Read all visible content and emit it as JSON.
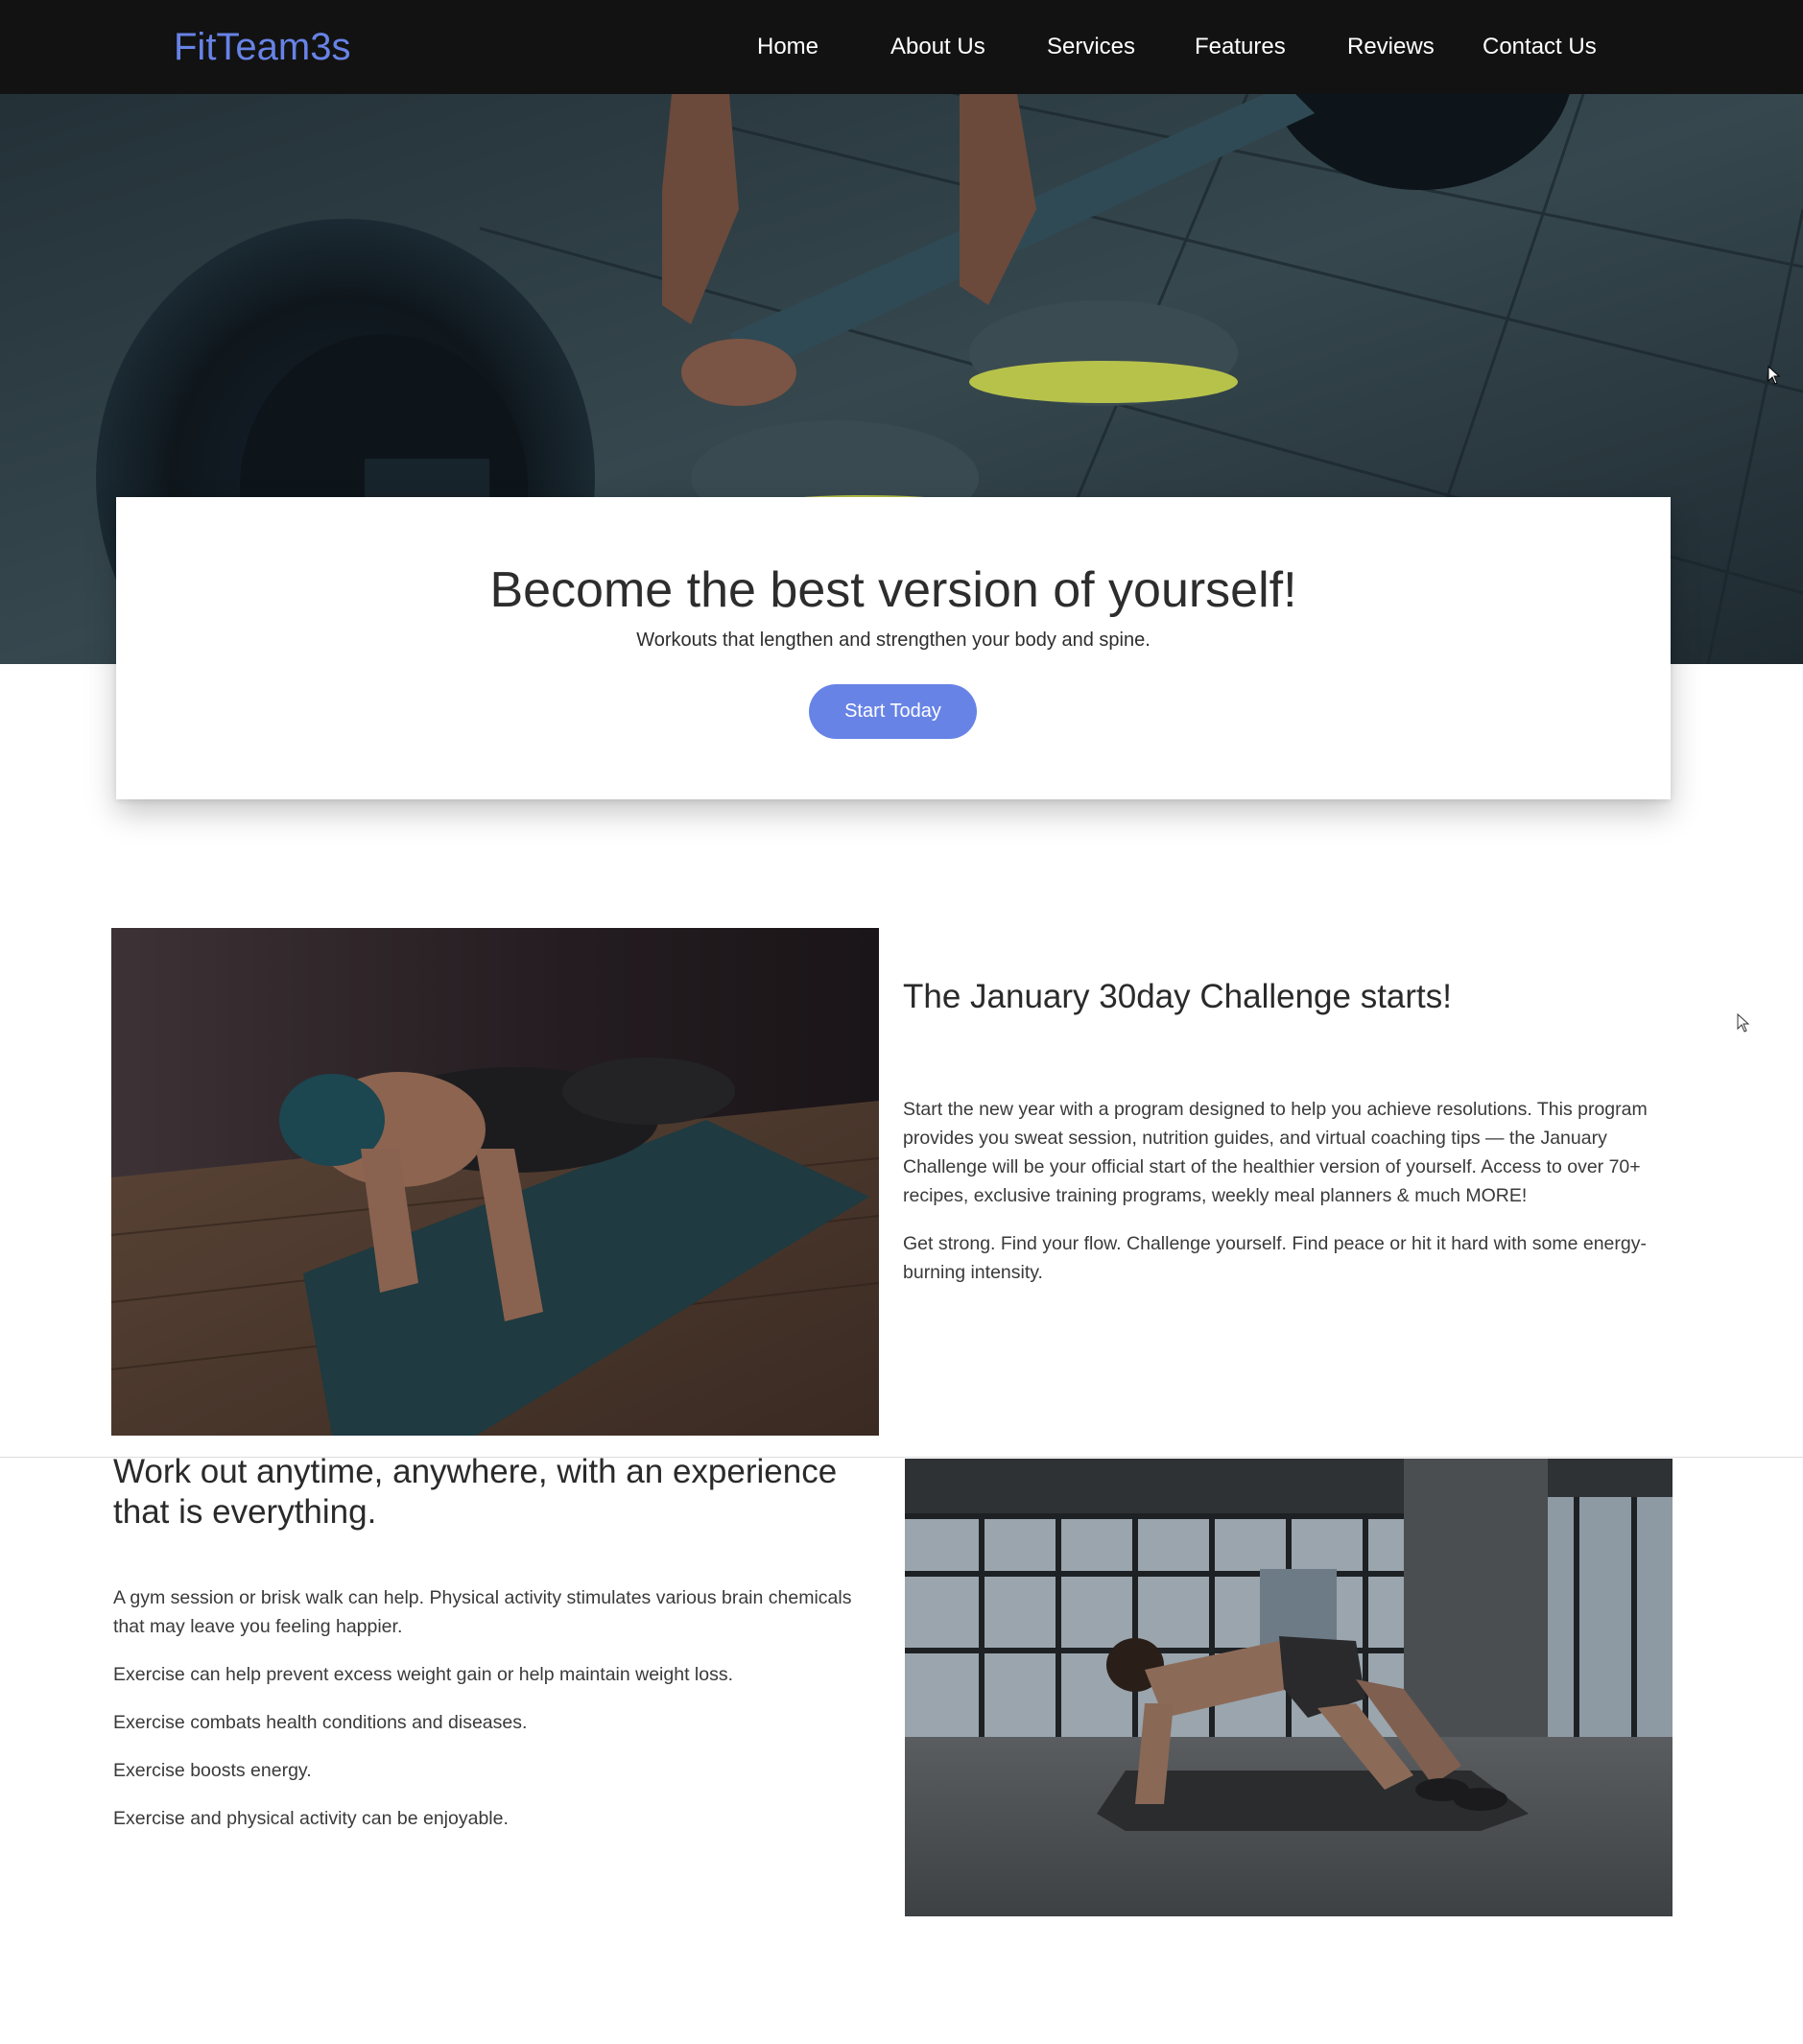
{
  "navbar": {
    "brand": "FitTeam3s",
    "items": [
      {
        "label": "Home"
      },
      {
        "label": "About Us"
      },
      {
        "label": "Services"
      },
      {
        "label": "Features"
      },
      {
        "label": "Reviews"
      },
      {
        "label": "Contact Us"
      }
    ]
  },
  "hero": {
    "title": "Become the best version of yourself!",
    "subtitle": "Workouts that lengthen and strengthen your body and spine.",
    "cta_label": "Start Today",
    "image_icon": "barbell-photo"
  },
  "section1": {
    "image_icon": "woman-pushup-photo",
    "title": "The January 30day Challenge starts!",
    "paragraphs": [
      "Start the new year with a program designed to help you achieve resolutions. This program provides you sweat session, nutrition guides, and virtual coaching tips — the January Challenge will be your official start of the healthier version of yourself. Access to over 70+ recipes, exclusive training programs, weekly meal planners & much MORE!",
      "Get strong. Find your flow. Challenge yourself. Find peace or hit it hard with some energy-burning intensity."
    ]
  },
  "section2": {
    "title": "Work out anytime, anywhere, with an experience that is everything.",
    "paragraphs": [
      "A gym session or brisk walk can help. Physical activity stimulates various brain chemicals that may leave you feeling happier.",
      "Exercise can help prevent excess weight gain or help maintain weight loss.",
      "Exercise combats health conditions and diseases.",
      "Exercise boosts energy.",
      "Exercise and physical activity can be enjoyable."
    ],
    "image_icon": "man-mountain-climber-photo"
  },
  "colors": {
    "navbar_bg": "#121212",
    "brand": "#6783e6",
    "accent": "#6783e6",
    "text": "#333333",
    "nav_text": "#ffffff"
  }
}
